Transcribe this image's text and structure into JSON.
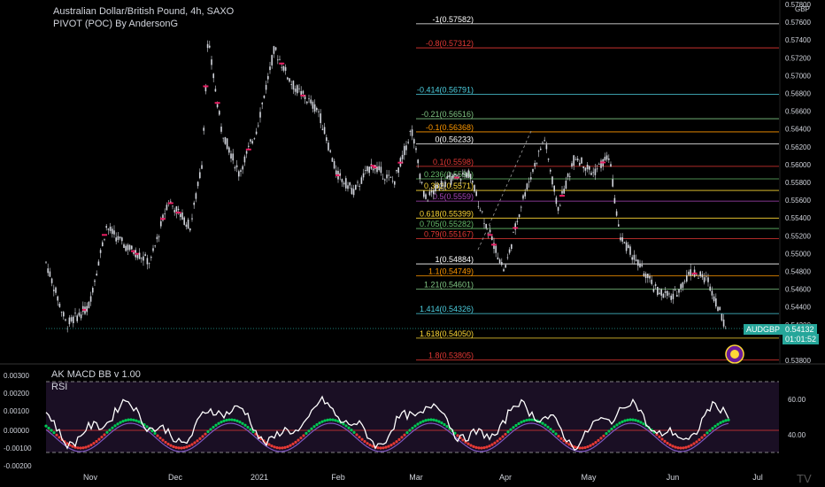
{
  "header": {
    "symbol_title": "Australian Dollar/British Pound, 4h, SAXO",
    "indicator_title": "PIVOT (POC) By AndersonG"
  },
  "price_axis": {
    "currency": "GBP",
    "ticks": [
      "0.57800",
      "0.57600",
      "0.57400",
      "0.57200",
      "0.57000",
      "0.56800",
      "0.56600",
      "0.56400",
      "0.56200",
      "0.56000",
      "0.55800",
      "0.55600",
      "0.55400",
      "0.55200",
      "0.55000",
      "0.54800",
      "0.54600",
      "0.54400",
      "0.54200",
      "0.53800"
    ],
    "last_price": "0.54132",
    "countdown": "01:01:52",
    "symbol_label": "AUDGBP"
  },
  "fib_levels": [
    {
      "label": "-1(0.57582)",
      "price": 0.57582,
      "color": "#ffffff"
    },
    {
      "label": "-0.8(0.57312)",
      "price": 0.57312,
      "color": "#e53935"
    },
    {
      "label": "-0.414(0.56791)",
      "price": 0.56791,
      "color": "#4dd0e1"
    },
    {
      "label": "-0.21(0.56516)",
      "price": 0.56516,
      "color": "#81c784"
    },
    {
      "label": "-0.1(0.56368)",
      "price": 0.56368,
      "color": "#ff9800"
    },
    {
      "label": "0(0.56233)",
      "price": 0.56233,
      "color": "#ffffff"
    },
    {
      "label": "0.1(0.5598)",
      "price": 0.5598,
      "color": "#e53935"
    },
    {
      "label": "0.236(0.5584)",
      "price": 0.5584,
      "color": "#66bb6a"
    },
    {
      "label": "0.382(0.5571)",
      "price": 0.5571,
      "color": "#fdd835"
    },
    {
      "label": "0.5(0.5559)",
      "price": 0.5559,
      "color": "#ab47bc"
    },
    {
      "label": "0.618(0.55399)",
      "price": 0.55399,
      "color": "#fdd835"
    },
    {
      "label": "0.705(0.55282)",
      "price": 0.55282,
      "color": "#66bb6a"
    },
    {
      "label": "0.79(0.55167)",
      "price": 0.55167,
      "color": "#e53935"
    },
    {
      "label": "1(0.54884)",
      "price": 0.54884,
      "color": "#ffffff"
    },
    {
      "label": "1.1(0.54749)",
      "price": 0.54749,
      "color": "#ff9800"
    },
    {
      "label": "1.21(0.54601)",
      "price": 0.54601,
      "color": "#81c784"
    },
    {
      "label": "1.414(0.54326)",
      "price": 0.54326,
      "color": "#4dd0e1"
    },
    {
      "label": "1.618(0.54050)",
      "price": 0.5405,
      "color": "#fdd835"
    },
    {
      "label": "1.8(0.53805)",
      "price": 0.53805,
      "color": "#e53935"
    }
  ],
  "lower_pane": {
    "macd_title": "AK MACD BB v 1.00",
    "rsi_title": "RSI",
    "left_ticks": [
      "0.00300",
      "0.00200",
      "0.00100",
      "0.00000",
      "-0.00100",
      "-0.00200"
    ],
    "right_ticks": [
      "60.00",
      "40.00"
    ]
  },
  "time_axis": {
    "labels": [
      "Nov",
      "Dec",
      "2021",
      "Feb",
      "Mar",
      "Apr",
      "May",
      "Jun",
      "Jul"
    ]
  },
  "colors": {
    "bg": "#000000",
    "candle": "#d1d4dc",
    "poc_marker": "#e91e63",
    "macd_up": "#00c853",
    "macd_down": "#e53935",
    "rsi": "#ffffff",
    "price_tag": "#26a69a"
  }
}
